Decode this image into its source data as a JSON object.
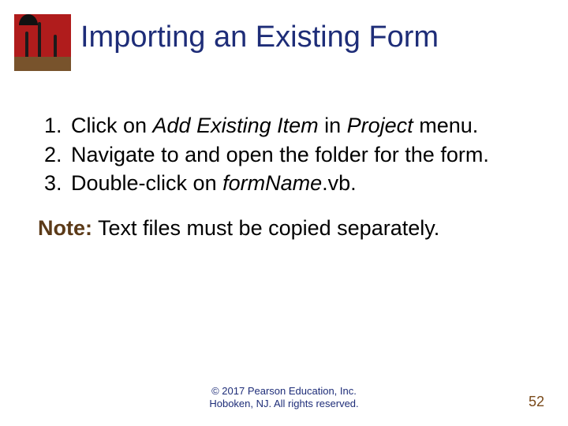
{
  "title": "Importing an Existing Form",
  "steps": {
    "s1a": "Click on ",
    "s1b": "Add Existing Item",
    "s1c": " in ",
    "s1d": "Project",
    "s1e": " menu.",
    "s2": "Navigate to and open the folder for the form.",
    "s3a": "Double-click on ",
    "s3b": "formName",
    "s3c": ".vb."
  },
  "note": {
    "label": "Note:",
    "text": " Text files must be copied separately."
  },
  "footer": {
    "line1": "© 2017 Pearson Education, Inc.",
    "line2": "Hoboken, NJ. All rights reserved."
  },
  "page_number": "52"
}
